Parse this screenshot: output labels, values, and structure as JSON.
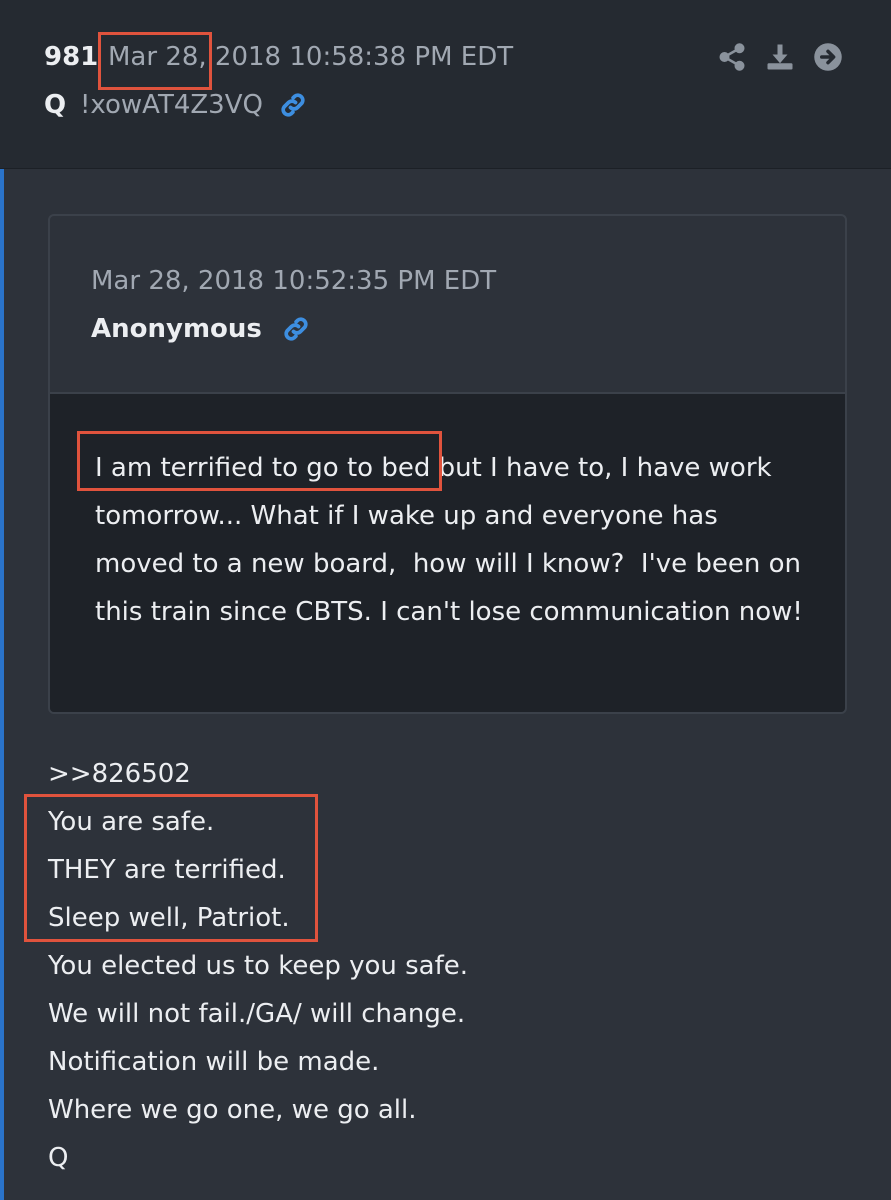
{
  "post": {
    "number": "981",
    "date": "Mar 28, 2018 10:58:38 PM EDT",
    "author": "Q",
    "tripcode": "!xowAT4Z3VQ",
    "header_icons": [
      "share-icon",
      "download-icon",
      "arrow-right-circle-icon"
    ]
  },
  "quoted_post": {
    "date": "Mar 28, 2018 10:52:35 PM EDT",
    "author": "Anonymous",
    "text": "I am terrified to go to bed but I have to, I have work tomorrow... What if I wake up and everyone has moved to a new board,  how will I know?  I've been on this train since CBTS. I can't lose communication now!"
  },
  "body_lines": [
    ">>826502",
    "You are safe.",
    "THEY are terrified.",
    "Sleep well, Patriot.",
    "You elected us to keep you safe.",
    "We will not fail./GA/ will change.",
    "Notification will be made.",
    "Where we go one, we go all.",
    "Q"
  ],
  "colors": {
    "background": "#2d323a",
    "header": "#252a31",
    "quote_body": "#1e2228",
    "link": "#3d8ee0",
    "annotation": "#e0533d",
    "accent": "#2a73c9"
  }
}
